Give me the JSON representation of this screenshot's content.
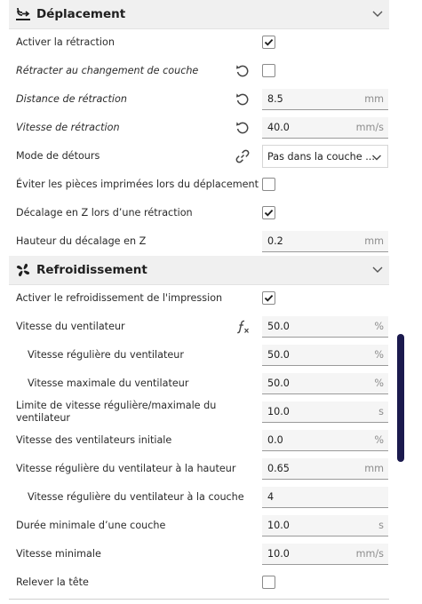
{
  "travel": {
    "title": "Déplacement",
    "icon": "travel-icon",
    "settings": {
      "retraction_enable": {
        "label": "Activer la rétraction",
        "checked": true
      },
      "retract_layer_change": {
        "label": "Rétracter au changement de couche",
        "checked": false
      },
      "retraction_distance": {
        "label": "Distance de rétraction",
        "value": "8.5",
        "unit": "mm"
      },
      "retraction_speed": {
        "label": "Vitesse de rétraction",
        "value": "40.0",
        "unit": "mm/s"
      },
      "combing_mode": {
        "label": "Mode de détours",
        "value": "Pas dans la couche ..."
      },
      "avoid_printed_parts": {
        "label": "Éviter les pièces imprimées lors du déplacement",
        "checked": false
      },
      "retraction_hop_enabled": {
        "label": "Décalage en Z lors d’une rétraction",
        "checked": true
      },
      "retraction_hop": {
        "label": "Hauteur du décalage en Z",
        "value": "0.2",
        "unit": "mm"
      }
    }
  },
  "cooling": {
    "title": "Refroidissement",
    "icon": "fan-icon",
    "settings": {
      "cool_fan_enabled": {
        "label": "Activer le refroidissement de l'impression",
        "checked": true
      },
      "cool_fan_speed": {
        "label": "Vitesse du ventilateur",
        "value": "50.0",
        "unit": "%"
      },
      "cool_fan_speed_min": {
        "label": "Vitesse régulière du ventilateur",
        "value": "50.0",
        "unit": "%"
      },
      "cool_fan_speed_max": {
        "label": "Vitesse maximale du ventilateur",
        "value": "50.0",
        "unit": "%"
      },
      "cool_min_layer_time_fan_speed_max": {
        "label": "Limite de vitesse régulière/maximale du ventilateur",
        "value": "10.0",
        "unit": "s"
      },
      "cool_fan_speed_0": {
        "label": "Vitesse des ventilateurs initiale",
        "value": "0.0",
        "unit": "%"
      },
      "cool_fan_full_at_height": {
        "label": "Vitesse régulière du ventilateur à la hauteur",
        "value": "0.65",
        "unit": "mm"
      },
      "cool_fan_full_layer": {
        "label": "Vitesse régulière du ventilateur à la couche",
        "value": "4",
        "unit": ""
      },
      "cool_min_layer_time": {
        "label": "Durée minimale d’une couche",
        "value": "10.0",
        "unit": "s"
      },
      "cool_min_speed": {
        "label": "Vitesse minimale",
        "value": "10.0",
        "unit": "mm/s"
      },
      "cool_lift_head": {
        "label": "Relever la tête",
        "checked": false
      }
    }
  },
  "colors": {
    "accent": "#1b1a4e",
    "header_bg": "#f0f0f0",
    "field_bg": "#f5f5f5"
  }
}
